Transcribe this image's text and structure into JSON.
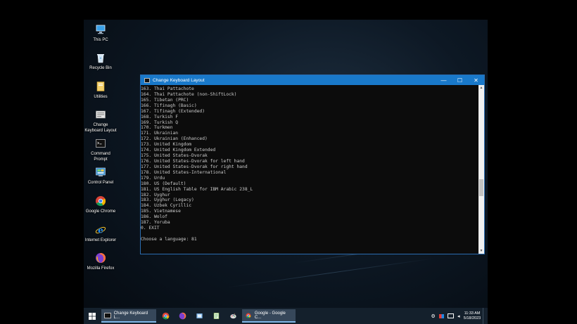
{
  "desktop": {
    "icons": [
      {
        "label": "This PC"
      },
      {
        "label": "Recycle Bin"
      },
      {
        "label": "Utilities"
      },
      {
        "label": "Change\nKeyboard Layout"
      },
      {
        "label": "Command\nPrompt"
      },
      {
        "label": "Control Panel"
      },
      {
        "label": "Google Chrome"
      },
      {
        "label": "Internet Explorer"
      },
      {
        "label": "Mozilla Firefox"
      }
    ]
  },
  "window": {
    "title": "Change Keyboard Layout",
    "minimize": "—",
    "maximize": "☐",
    "close": "✕",
    "console_lines": [
      "163. Thai Pattachote",
      "164. Thai Pattachote (non-ShiftLock)",
      "165. Tibetan (PRC)",
      "166. Tifinagh (Basic)",
      "167. Tifinagh (Extended)",
      "168. Turkish F",
      "169. Turkish Q",
      "170. Turkmen",
      "171. Ukrainian",
      "172. Ukrainian (Enhanced)",
      "173. United Kingdom",
      "174. United Kingdom Extended",
      "175. United States-Dvorak",
      "176. United States-Dvorak for left hand",
      "177. United States-Dvorak for right hand",
      "178. United States-International",
      "179. Urdu",
      "180. US (Default)",
      "181. US English Table for IBM Arabic 238_L",
      "182. Uyghur",
      "183. Uyghur (Legacy)",
      "184. Uzbek Cyrillic",
      "185. Vietnamese",
      "186. Wolof",
      "187. Yoruba",
      "0. EXIT",
      "",
      "Choose a language: 81"
    ]
  },
  "taskbar": {
    "items": [
      {
        "label": "Change Keyboard L..."
      },
      {
        "label": "Google - Google C..."
      }
    ],
    "clock_time": "11:33 AM",
    "clock_date": "5/18/2023"
  },
  "colors": {
    "accent": "#1979ca",
    "console_bg": "#0c0c0c",
    "console_text": "#cccccc",
    "taskbar_bg": "#14202c"
  }
}
